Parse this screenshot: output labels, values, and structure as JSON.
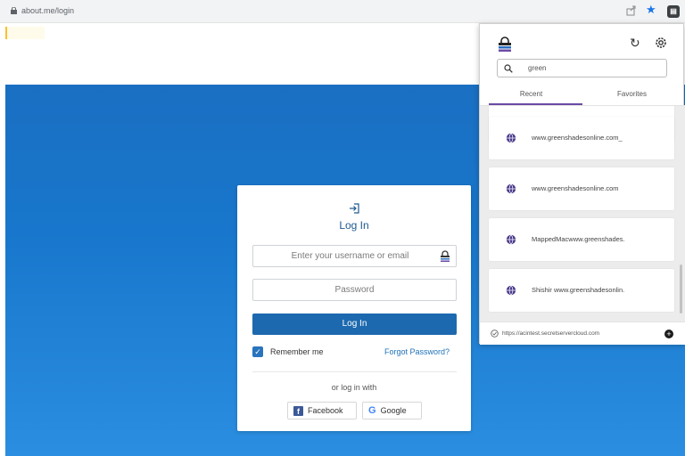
{
  "browser": {
    "url": "about.me/login"
  },
  "login": {
    "title": "Log In",
    "username_placeholder": "Enter your username or email",
    "password_placeholder": "Password",
    "login_button": "Log In",
    "remember_label": "Remember me",
    "remember_checked": true,
    "forgot_password": "Forgot Password?",
    "or_text": "or log in with",
    "facebook_label": "Facebook",
    "google_label": "Google"
  },
  "popup": {
    "search_value": "green",
    "tabs": [
      "Recent",
      "Favorites"
    ],
    "active_tab": "Recent",
    "items": [
      {
        "label": "www.greenshadesonline.com_",
        "icon": "globe-icon"
      },
      {
        "label": "www.greenshadesonline.com",
        "icon": "globe-icon"
      },
      {
        "label": "MappedMacwww.greenshades.",
        "icon": "globe-icon"
      },
      {
        "label": "Shishir www.greenshadesonlin.",
        "icon": "globe-icon"
      }
    ],
    "footer_url": "https://acintest.secretservercloud.com",
    "accent_color": "#6b4aa5"
  },
  "colors": {
    "page_background": "#1a6fc2",
    "login_button": "#1d69af",
    "link": "#2272b8"
  }
}
